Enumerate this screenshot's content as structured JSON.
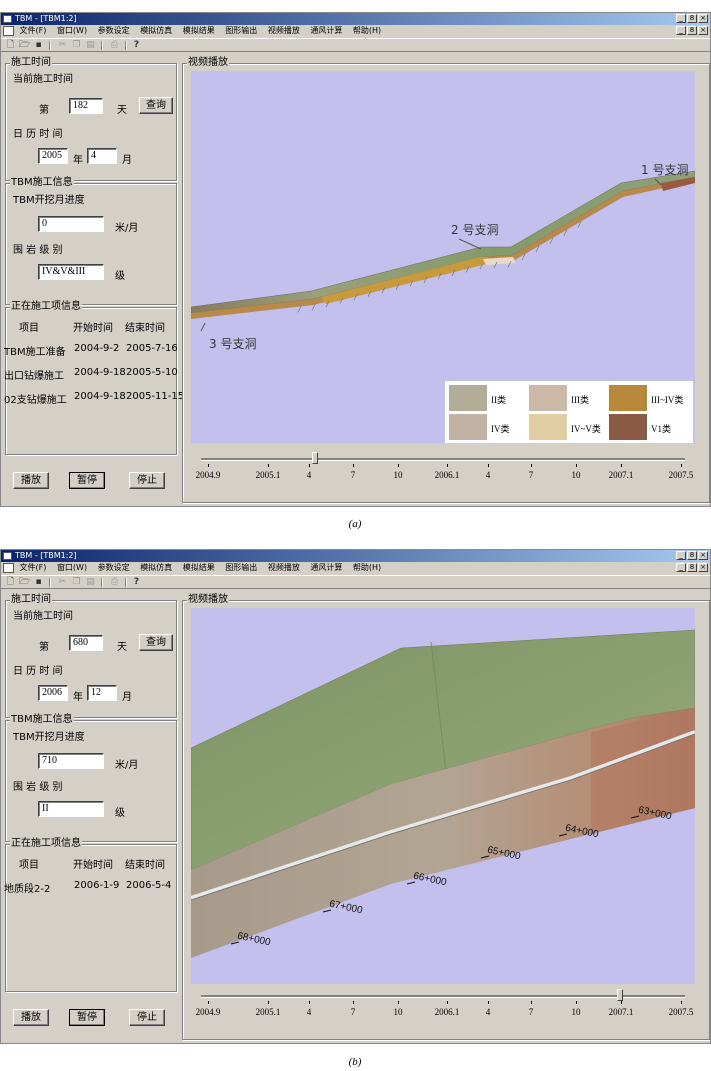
{
  "window_title": "TBM - [TBM1:2]",
  "menu": [
    "文件(F)",
    "窗口(W)",
    "参数设定",
    "模拟仿真",
    "模拟结果",
    "图形输出",
    "视频播放",
    "通风计算",
    "帮助(H)"
  ],
  "window_controls": [
    "_",
    "8",
    "×"
  ],
  "labels": {
    "construction_time_group": "施工时间",
    "current_construction_time": "当前施工时间",
    "day_prefix": "第",
    "day_suffix": "天",
    "query_button": "查询",
    "calendar_time": "日 历 时 间",
    "year_unit": "年",
    "month_unit": "月",
    "tbm_info_group": "TBM施工信息",
    "tbm_monthly_progress": "TBM开挖月进度",
    "progress_unit": "米/月",
    "rock_grade_label": "围 岩 级 别",
    "grade_unit": "级",
    "current_items_group": "正在施工项信息",
    "col_item": "项目",
    "col_start": "开始时间",
    "col_end": "结束时间",
    "video_group": "视频播放",
    "play_button": "播放",
    "pause_button": "暂停",
    "stop_button": "停止"
  },
  "timeline_ticks": [
    "2004.9",
    "2005.1",
    "4",
    "7",
    "10",
    "2006.1",
    "4",
    "7",
    "10",
    "2007.1",
    "2007.5"
  ],
  "panel_a": {
    "caption": "(a)",
    "day": "182",
    "year": "2005",
    "month": "4",
    "monthly_progress": "0",
    "rock_grade": "IV&V&III",
    "slider_fraction": 0.235,
    "items": [
      {
        "name": "TBM施工准备",
        "start": "2004-9-2",
        "end": "2005-7-16"
      },
      {
        "name": "出口钻爆施工",
        "start": "2004-9-18",
        "end": "2005-5-10"
      },
      {
        "name": "02支钻爆施工",
        "start": "2004-9-18",
        "end": "2005-11-15"
      }
    ],
    "annotations": [
      "1 号支洞",
      "2 号支洞",
      "3 号支洞"
    ],
    "legend": [
      {
        "label": "II类",
        "color": "#b2ad98"
      },
      {
        "label": "III类",
        "color": "#cdb9a8"
      },
      {
        "label": "III~IV类",
        "color": "#b8893a"
      },
      {
        "label": "IV类",
        "color": "#c1b2a3"
      },
      {
        "label": "IV~V类",
        "color": "#e2cda3"
      },
      {
        "label": "V1类",
        "color": "#8a5a45"
      }
    ]
  },
  "panel_b": {
    "caption": "(b)",
    "day": "680",
    "year": "2006",
    "month": "12",
    "monthly_progress": "710",
    "rock_grade": "II",
    "slider_fraction": 0.865,
    "items": [
      {
        "name": "地质段2-2",
        "start": "2006-1-9",
        "end": "2006-5-4"
      }
    ],
    "stations": [
      "63+000",
      "64+000",
      "65+000",
      "66+000",
      "67+000",
      "68+000"
    ]
  }
}
